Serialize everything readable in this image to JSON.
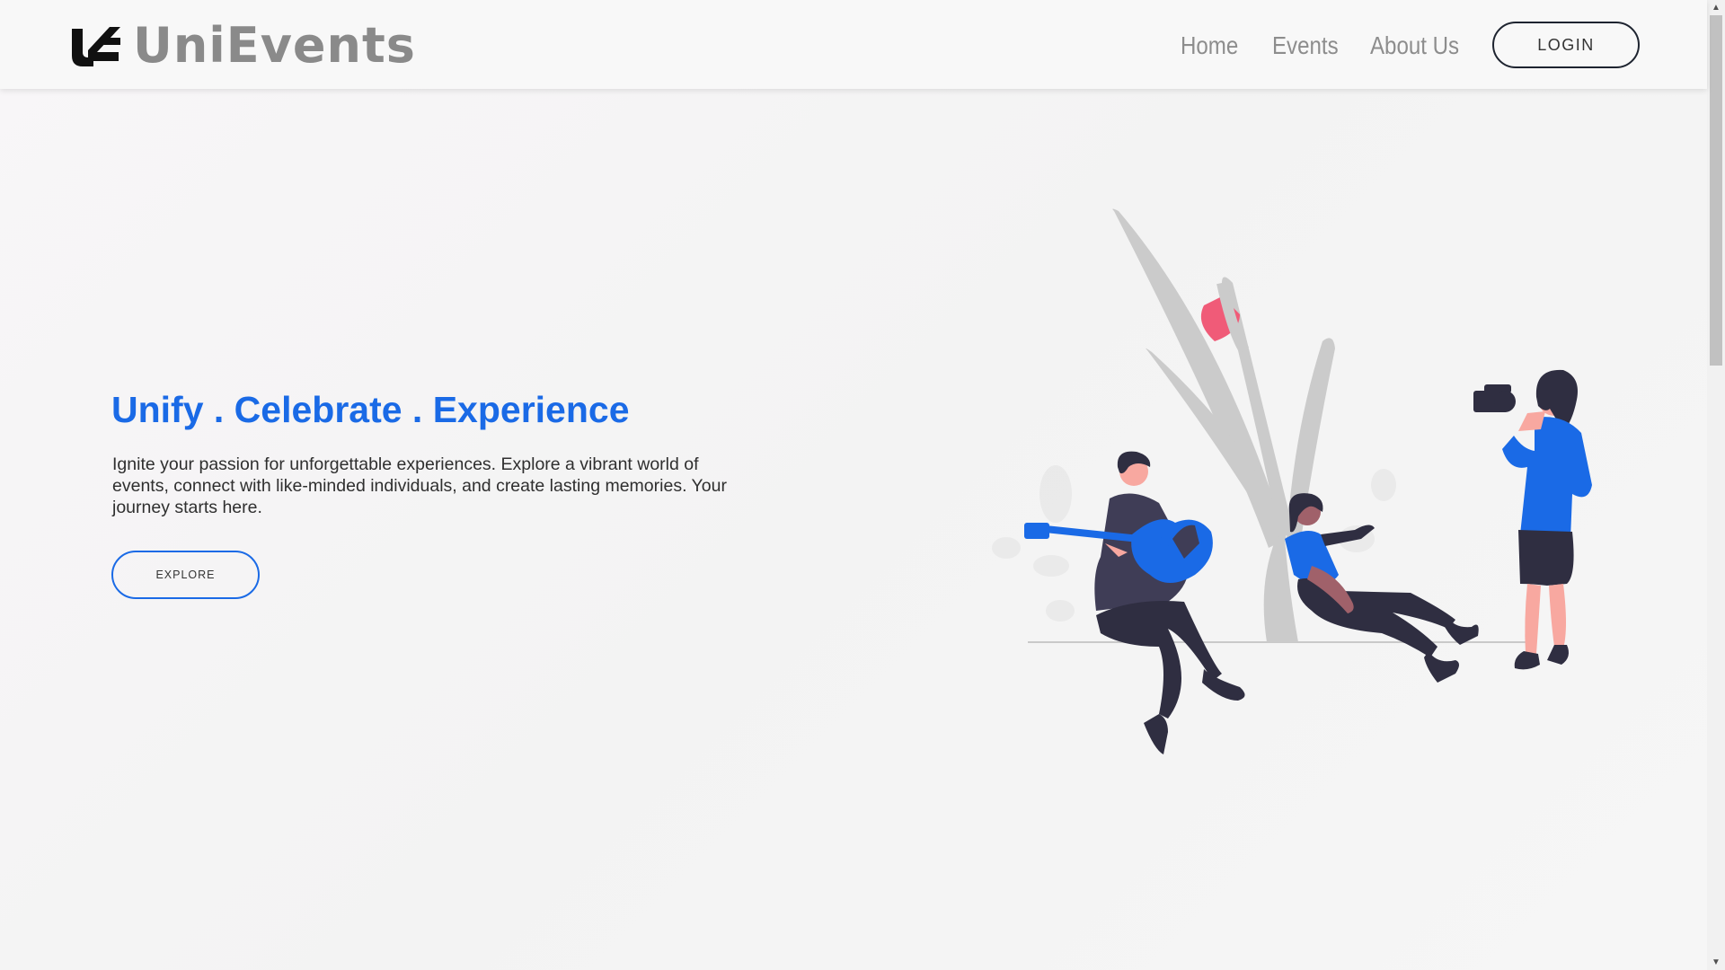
{
  "brand": {
    "name": "UniEvents",
    "logo_icon": "ue-monogram-icon"
  },
  "nav": {
    "links": [
      "Home",
      "Events",
      "About Us"
    ],
    "login_label": "LOGIN"
  },
  "hero": {
    "title": "Unify . Celebrate . Experience",
    "description": "Ignite your passion for unforgettable experiences. Explore a vibrant world of events, connect with like-minded individuals, and create lasting memories. Your journey starts here.",
    "explore_label": "EXPLORE",
    "illustration": "people-making-music-and-photographing-illustration"
  },
  "colors": {
    "accent": "#1a6ae6",
    "dark": "#2f2e41",
    "skin": "#f8a8a0",
    "plant": "#cbcbcb",
    "flower": "#f05b78"
  },
  "scrollbar": {
    "up_icon": "scroll-up-arrow-icon",
    "down_icon": "scroll-down-arrow-icon"
  }
}
